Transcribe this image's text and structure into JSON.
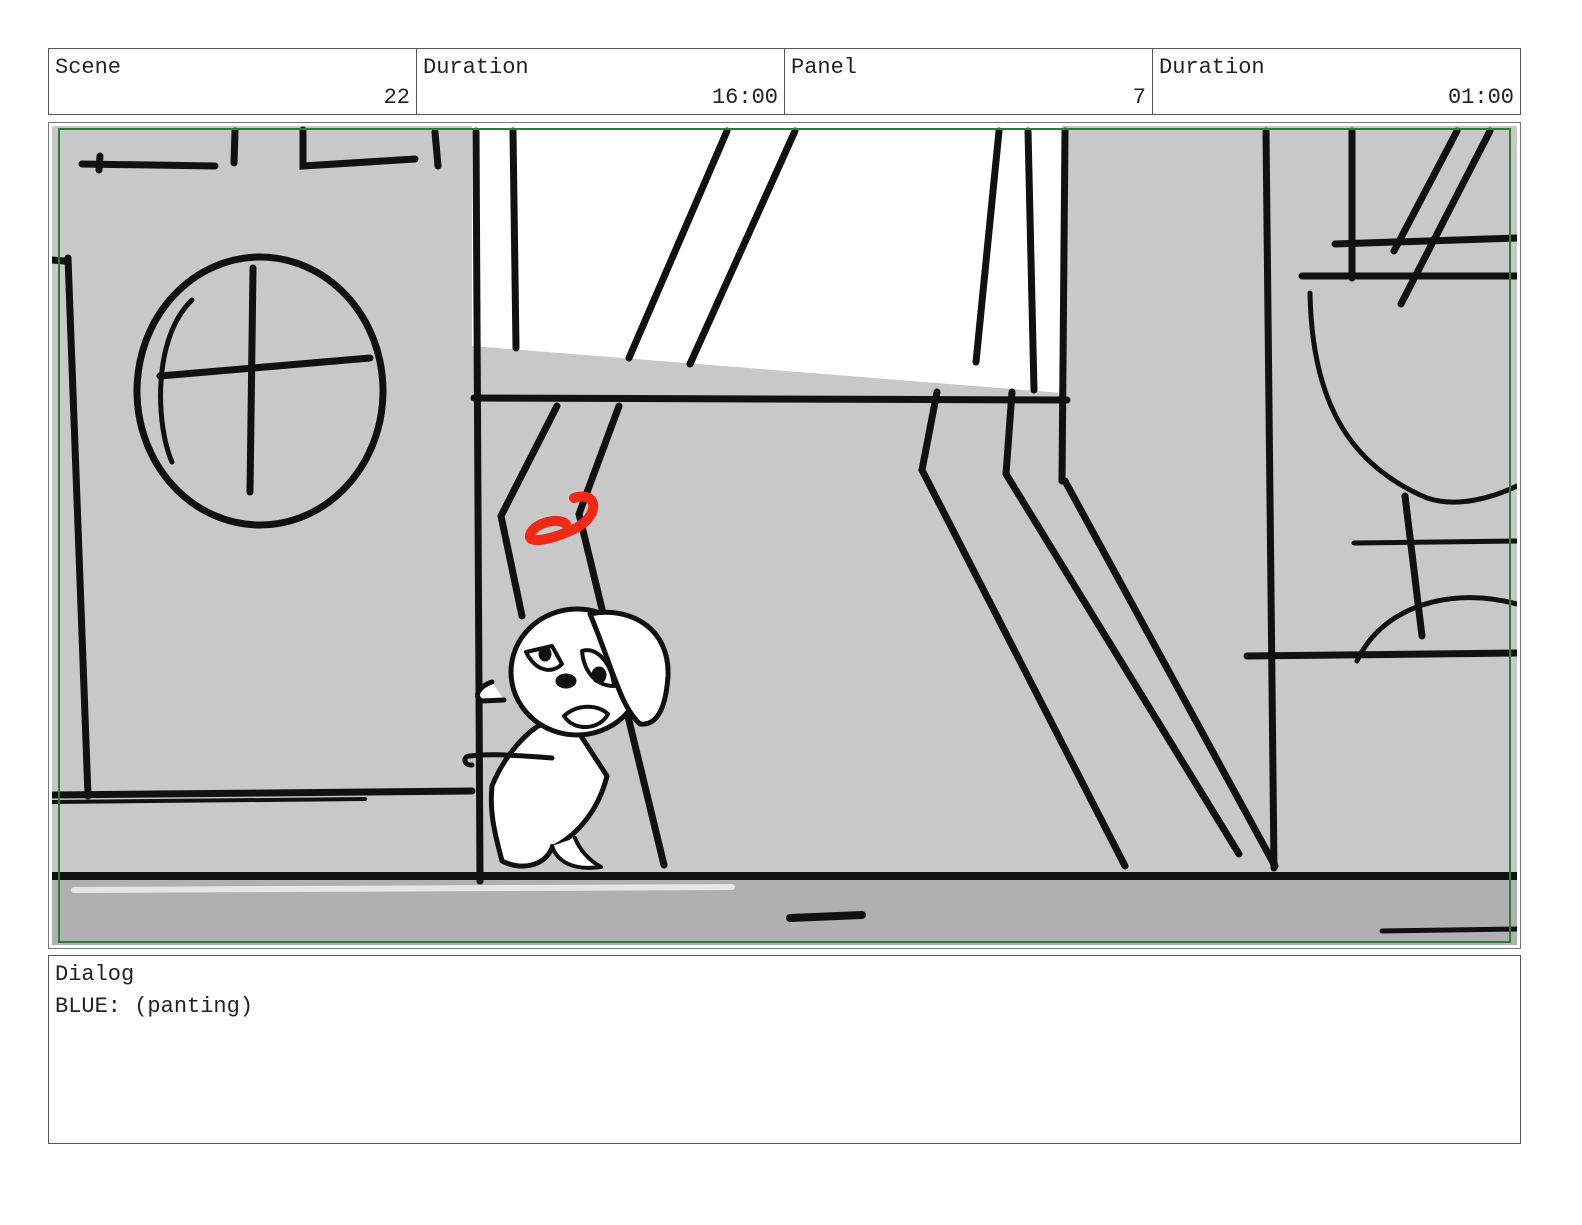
{
  "header": {
    "scene_label": "Scene",
    "scene_value": "22",
    "scene_duration_label": "Duration",
    "scene_duration_value": "16:00",
    "panel_label": "Panel",
    "panel_value": "7",
    "panel_duration_label": "Duration",
    "panel_duration_value": "01:00"
  },
  "dialog": {
    "label": "Dialog",
    "text": "BLUE: (panting)"
  },
  "colors": {
    "safe_frame": "#2e7d32",
    "background_gray": "#c8c8c8",
    "floor_gray": "#b0b0b0",
    "ink": "#111111",
    "red_mark": "#ee2a16"
  }
}
